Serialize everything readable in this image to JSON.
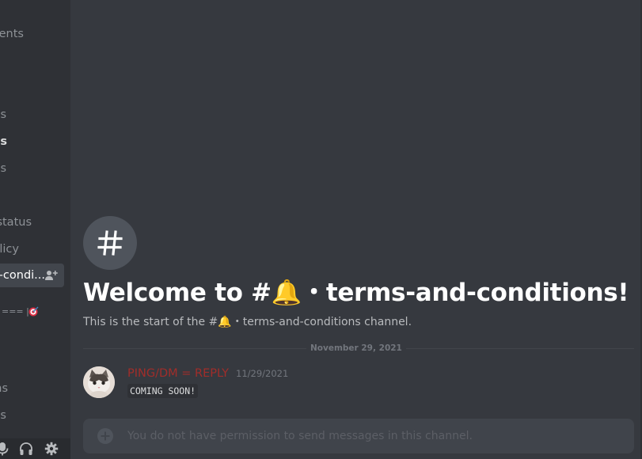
{
  "sidebar": {
    "channels": [
      {
        "label": "ments"
      },
      {
        "label": "s"
      },
      {
        "label": "es"
      },
      {
        "label": "s"
      },
      {
        "label": "status"
      },
      {
        "label": "licy"
      },
      {
        "label": "-condi..."
      },
      {
        "label": "ns"
      },
      {
        "label": "es"
      }
    ],
    "divider_text": "=== |",
    "user_bar": {
      "icons": [
        "microphone-icon",
        "headphones-icon",
        "settings-icon"
      ]
    }
  },
  "channel": {
    "welcome_title": "Welcome to #🔔・terms-and-conditions!",
    "start_text": "This is the start of the #🔔・terms-and-conditions channel."
  },
  "messages": {
    "date_divider": "November 29, 2021",
    "items": [
      {
        "author": "PING/DM = REPLY",
        "author_color": "#a12d2a",
        "timestamp": "11/29/2021",
        "content": "COMING SOON!"
      }
    ]
  },
  "composer": {
    "placeholder": "You do not have permission to send messages in this channel."
  },
  "colors": {
    "background": "#36393f",
    "sidebar": "#2f3136",
    "active_channel": "#42464d",
    "composer": "#40444b"
  }
}
